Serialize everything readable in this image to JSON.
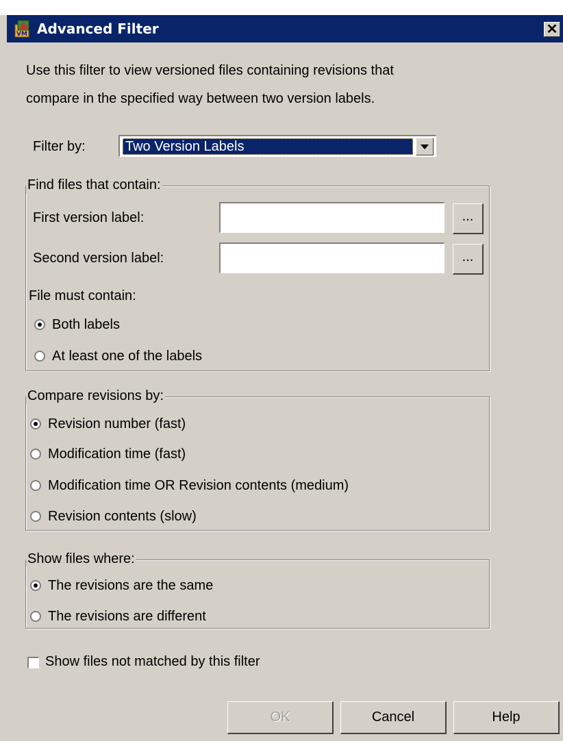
{
  "window": {
    "title": "Advanced Filter",
    "close_glyph": "✕"
  },
  "description": {
    "line1": "Use this filter to view versioned files containing revisions that",
    "line2": "compare in the specified way between two version labels."
  },
  "filter_by": {
    "label": "Filter by:",
    "selected": "Two Version Labels"
  },
  "find_group": {
    "legend": "Find files that contain:",
    "first_label": "First version label:",
    "first_value": "",
    "second_label": "Second version label:",
    "second_value": "",
    "browse_label": "...",
    "must_contain": "File must contain:",
    "options": [
      {
        "label": "Both labels",
        "checked": true
      },
      {
        "label": "At least one of the labels",
        "checked": false
      }
    ]
  },
  "compare_group": {
    "legend": "Compare revisions by:",
    "options": [
      {
        "label": "Revision number (fast)",
        "checked": true
      },
      {
        "label": "Modification time (fast)",
        "checked": false
      },
      {
        "label": "Modification time OR Revision contents (medium)",
        "checked": false
      },
      {
        "label": "Revision contents (slow)",
        "checked": false
      }
    ]
  },
  "show_group": {
    "legend": "Show files where:",
    "options": [
      {
        "label": "The revisions are the same",
        "checked": true
      },
      {
        "label": "The revisions are different",
        "checked": false
      }
    ]
  },
  "show_unmatched": {
    "label": "Show files not matched by this filter",
    "checked": false
  },
  "buttons": {
    "ok": "OK",
    "cancel": "Cancel",
    "help": "Help"
  },
  "colors": {
    "titlebar": "#0a246a",
    "dialog": "#d4d0c8",
    "disabled_text": "#a0a0a0"
  }
}
